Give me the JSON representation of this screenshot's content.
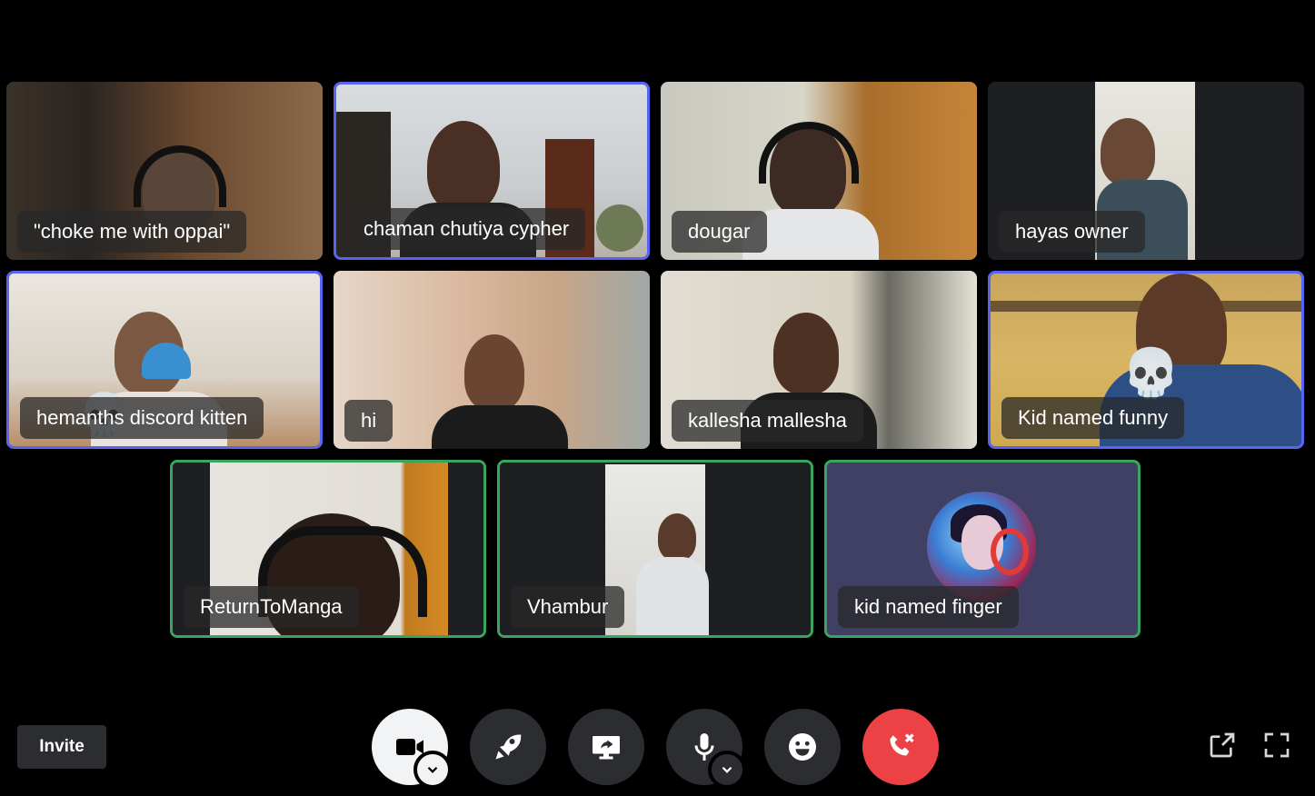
{
  "participants": [
    {
      "name": "\"choke me with oppai\""
    },
    {
      "name": "chaman chutiya cypher"
    },
    {
      "name": "dougar"
    },
    {
      "name": "hayas owner"
    },
    {
      "name": "hemanths discord kitten"
    },
    {
      "name": "hi"
    },
    {
      "name": "kallesha mallesha"
    },
    {
      "name": "Kid named funny"
    },
    {
      "name": "ReturnToManga"
    },
    {
      "name": "Vhambur"
    },
    {
      "name": "kid named finger"
    }
  ],
  "toolbar": {
    "invite_label": "Invite",
    "buttons": [
      "camera-icon",
      "activity-rocket-icon",
      "screen-share-icon",
      "microphone-icon",
      "soundboard-emoji-icon",
      "disconnect-icon"
    ]
  },
  "colors": {
    "speaking_border": "#5865f2",
    "connected_border": "#3ba55d",
    "disconnect_red": "#ed4245",
    "control_bg": "#2b2d31"
  }
}
